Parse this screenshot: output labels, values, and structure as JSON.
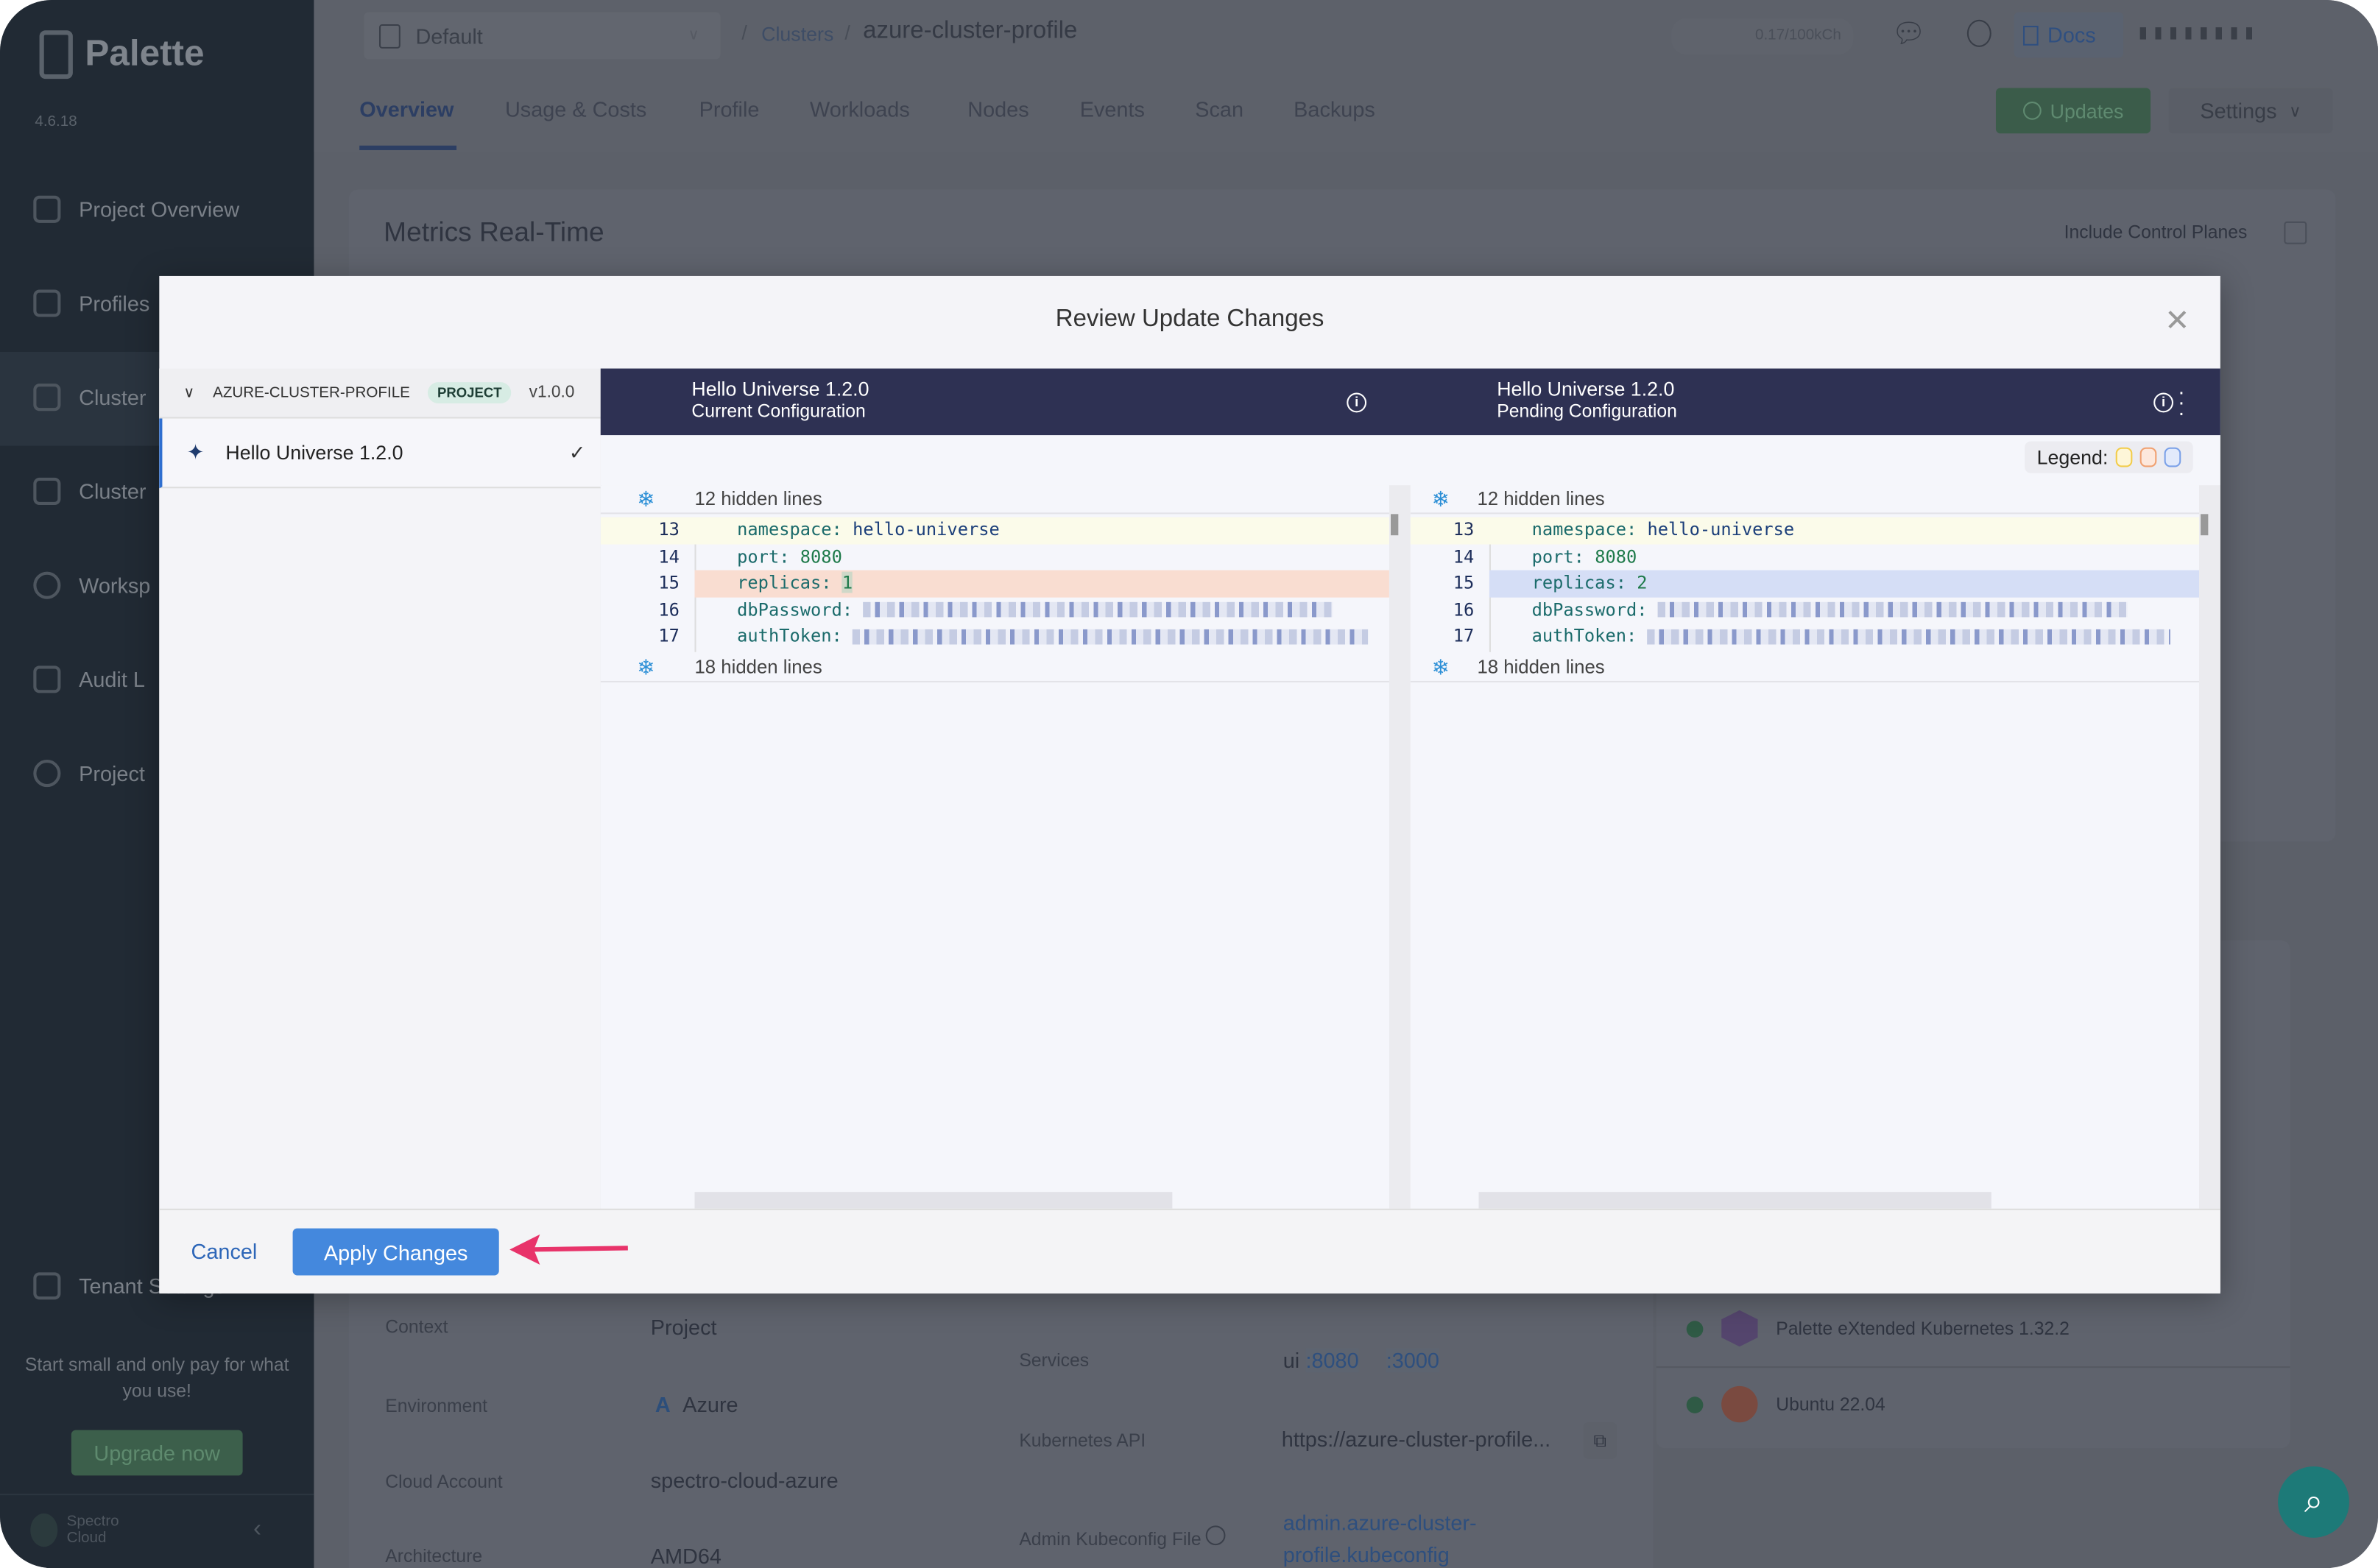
{
  "sidebar": {
    "brand": "Palette",
    "version": "4.6.18",
    "items": [
      {
        "label": "Project Overview",
        "icon": "chart-icon"
      },
      {
        "label": "Profiles",
        "icon": "stack-icon"
      },
      {
        "label": "Cluster",
        "icon": "clusters-icon"
      },
      {
        "label": "Cluster",
        "icon": "cluster-groups-icon"
      },
      {
        "label": "Worksp",
        "icon": "workspaces-icon"
      },
      {
        "label": "Audit L",
        "icon": "audit-icon"
      },
      {
        "label": "Project",
        "icon": "gear-icon"
      },
      {
        "label": "Tenant Settings",
        "icon": "tools-icon"
      }
    ],
    "promo": "Start small and only pay for what you use!",
    "upgrade": "Upgrade now",
    "company_line1": "Spectro",
    "company_line2": "Cloud"
  },
  "header": {
    "project": "Default",
    "breadcrumb_parent": "Clusters",
    "breadcrumb_current": "azure-cluster-profile",
    "usage": "0.17/100kCh",
    "docs": "Docs",
    "tabs": [
      "Overview",
      "Usage & Costs",
      "Profile",
      "Workloads",
      "Nodes",
      "Events",
      "Scan",
      "Backups"
    ],
    "active_tab": "Overview",
    "updates": "Updates",
    "settings": "Settings"
  },
  "metrics": {
    "title": "Metrics Real-Time",
    "include_cp": "Include Control Planes"
  },
  "details": {
    "context_label": "Context",
    "context": "Project",
    "environment_label": "Environment",
    "environment": "Azure",
    "cloud_account_label": "Cloud Account",
    "cloud_account": "spectro-cloud-azure",
    "architecture_label": "Architecture",
    "architecture": "AMD64",
    "services_label": "Services",
    "services_ui": "ui",
    "port1": ":8080",
    "port2": ":3000",
    "k8s_api_label": "Kubernetes API",
    "k8s_api": "https://azure-cluster-profile...",
    "kubeconfig_label": "Admin Kubeconfig File",
    "kubeconfig_1": "admin.azure-cluster-",
    "kubeconfig_2": "profile.kubeconfig"
  },
  "layers": [
    "Palette eXtended Kubernetes 1.32.2",
    "Ubuntu 22.04"
  ],
  "modal": {
    "title": "Review Update Changes",
    "profile_name": "AZURE-CLUSTER-PROFILE",
    "profile_scope": "PROJECT",
    "profile_version": "v1.0.0",
    "pack": "Hello Universe 1.2.0",
    "left": {
      "title": "Hello Universe 1.2.0",
      "subtitle": "Current Configuration"
    },
    "right": {
      "title": "Hello Universe 1.2.0",
      "subtitle": "Pending Configuration"
    },
    "legend": "Legend:",
    "legend_colors": [
      "#f2cc4a",
      "#f0a070",
      "#7aa0e8"
    ],
    "hidden_top": "12 hidden lines",
    "hidden_bottom": "18 hidden lines",
    "lines": {
      "n13": "13",
      "n14": "14",
      "n15": "15",
      "n16": "16",
      "n17": "17",
      "k13": "namespace",
      "v13": "hello-universe",
      "k14": "port",
      "v14": "8080",
      "k15": "replicas",
      "v15_left": "1",
      "v15_right": "2",
      "k16": "dbPassword",
      "k17": "authToken"
    },
    "cancel": "Cancel",
    "apply": "Apply Changes"
  }
}
